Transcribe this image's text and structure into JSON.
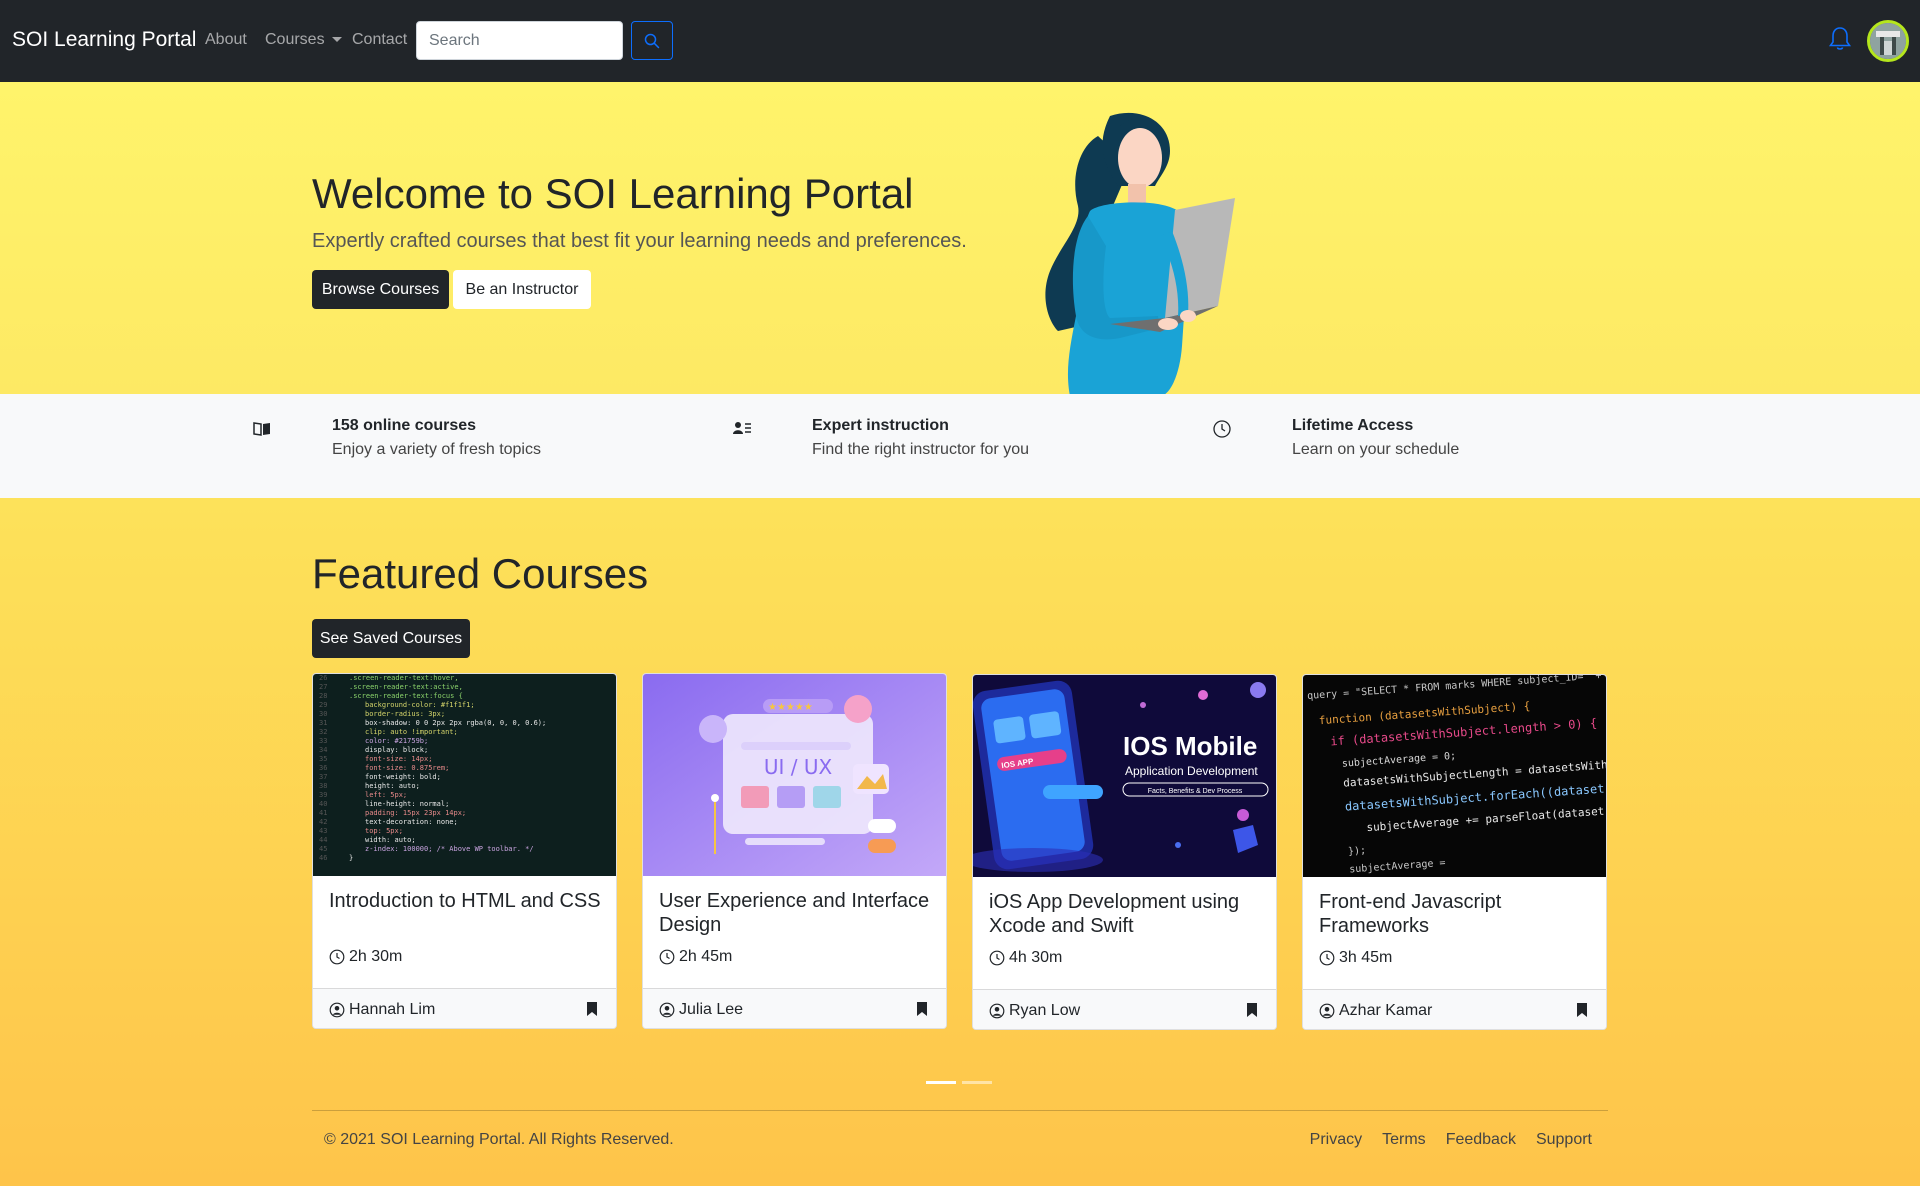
{
  "navbar": {
    "brand": "SOI Learning Portal",
    "links": [
      "About",
      "Courses",
      "Contact"
    ],
    "search_placeholder": "Search"
  },
  "hero": {
    "title": "Welcome to SOI Learning Portal",
    "subtitle": "Expertly crafted courses that best fit your learning needs and preferences.",
    "browse_label": "Browse Courses",
    "instructor_label": "Be an Instructor"
  },
  "features": [
    {
      "icon": "book-icon",
      "title": "158 online courses",
      "desc": "Enjoy a variety of fresh topics"
    },
    {
      "icon": "person-lines-icon",
      "title": "Expert instruction",
      "desc": "Find the right instructor for you"
    },
    {
      "icon": "clock-icon",
      "title": "Lifetime Access",
      "desc": "Learn on your schedule"
    }
  ],
  "featured": {
    "title": "Featured Courses",
    "saved_label": "See Saved Courses",
    "courses": [
      {
        "title": "Introduction to HTML and CSS",
        "duration": "2h 30m",
        "instructor": "Hannah Lim"
      },
      {
        "title": "User Experience and Interface Design",
        "duration": "2h 45m",
        "instructor": "Julia Lee",
        "thumb_text": "UI / UX"
      },
      {
        "title": "iOS App Development using Xcode and Swift",
        "duration": "4h 30m",
        "instructor": "Ryan Low",
        "thumb_title": "IOS Mobile",
        "thumb_subtitle": "Application Development",
        "thumb_tag": "Facts, Benefits & Dev Process",
        "thumb_app": "IOS APP"
      },
      {
        "title": "Front-end Javascript Frameworks",
        "duration": "3h 45m",
        "instructor": "Azhar Kamar"
      }
    ]
  },
  "footer": {
    "copyright": "© 2021 SOI Learning Portal. All Rights Reserved.",
    "links": [
      "Privacy",
      "Terms",
      "Feedback",
      "Support"
    ]
  },
  "colors": {
    "navbar": "#212529",
    "accent": "#0d6efd",
    "hero_bg": "#fff46b",
    "main_bg": "#fec44a"
  }
}
